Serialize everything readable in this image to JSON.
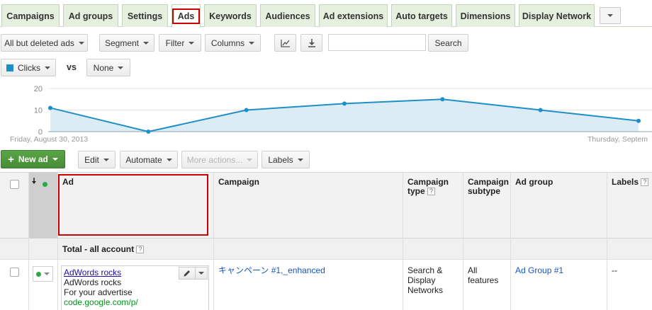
{
  "tabs": [
    {
      "label": "Campaigns",
      "active": false
    },
    {
      "label": "Ad groups",
      "active": false
    },
    {
      "label": "Settings",
      "active": false
    },
    {
      "label": "Ads",
      "active": true
    },
    {
      "label": "Keywords",
      "active": false
    },
    {
      "label": "Audiences",
      "active": false
    },
    {
      "label": "Ad extensions",
      "active": false
    },
    {
      "label": "Auto targets",
      "active": false
    },
    {
      "label": "Dimensions",
      "active": false
    },
    {
      "label": "Display Network",
      "active": false
    }
  ],
  "toolbar": {
    "filter_status": "All but deleted ads",
    "segment": "Segment",
    "filter": "Filter",
    "columns": "Columns",
    "search_value": "",
    "search_button": "Search"
  },
  "metrics": {
    "metric_primary": "Clicks",
    "metric_primary_color": "#1e8fc7",
    "vs_label": "vs",
    "metric_secondary": "None"
  },
  "chart_data": {
    "type": "area",
    "series": [
      {
        "name": "Clicks",
        "values": [
          11,
          0,
          10,
          13,
          15,
          10,
          5
        ]
      }
    ],
    "ylim": [
      0,
      20
    ],
    "yticks": [
      "0",
      "10",
      "20"
    ],
    "start_label": "Friday, August 30, 2013",
    "end_label": "Thursday, Septem",
    "grid": true,
    "line_color": "#1e8fc7",
    "fill_color": "#dcecf5"
  },
  "actions": {
    "new_ad": "New ad",
    "edit": "Edit",
    "automate": "Automate",
    "more_actions": "More actions...",
    "labels": "Labels"
  },
  "table": {
    "headers": {
      "ad": "Ad",
      "campaign": "Campaign",
      "campaign_type_line1": "Campaign",
      "campaign_type_line2": "type",
      "campaign_subtype_line1": "Campaign",
      "campaign_subtype_line2": "subtype",
      "ad_group": "Ad group",
      "labels": "Labels",
      "help": "?"
    },
    "total_label": "Total - all account",
    "rows": [
      {
        "ad_headline": "AdWords rocks",
        "ad_line1": "AdWords rocks",
        "ad_line2": "For your advertise",
        "ad_display_url": "code.google.com/p/",
        "campaign": "キャンペーン #1,_enhanced",
        "campaign_type_1": "Search &",
        "campaign_type_2": "Display",
        "campaign_type_3": "Networks",
        "campaign_subtype_1": "All",
        "campaign_subtype_2": "features",
        "ad_group": "Ad Group #1",
        "labels": "--"
      }
    ]
  }
}
